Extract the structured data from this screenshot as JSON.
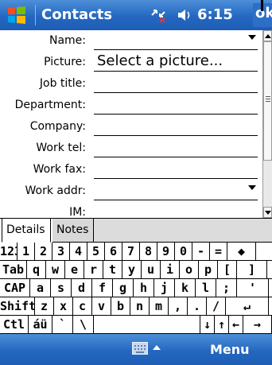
{
  "titlebar": {
    "title": "Contacts",
    "time": "6:15",
    "ok_label": "ok"
  },
  "form": {
    "fields": [
      {
        "label": "Name:",
        "value": "",
        "dropdown": true
      },
      {
        "label": "Picture:",
        "value": "Select a picture...",
        "dropdown": false
      },
      {
        "label": "Job title:",
        "value": "",
        "dropdown": false
      },
      {
        "label": "Department:",
        "value": "",
        "dropdown": false
      },
      {
        "label": "Company:",
        "value": "",
        "dropdown": false
      },
      {
        "label": "Work tel:",
        "value": "",
        "dropdown": false
      },
      {
        "label": "Work fax:",
        "value": "",
        "dropdown": false
      },
      {
        "label": "Work addr:",
        "value": "",
        "dropdown": true
      },
      {
        "label": "IM:",
        "value": "",
        "dropdown": false
      }
    ]
  },
  "tabs": {
    "details": "Details",
    "notes": "Notes"
  },
  "keyboard": {
    "row1": [
      "123",
      "1",
      "2",
      "3",
      "4",
      "5",
      "6",
      "7",
      "8",
      "9",
      "0",
      "-",
      "=",
      "◆"
    ],
    "row2": [
      "Tab",
      "q",
      "w",
      "e",
      "r",
      "t",
      "y",
      "u",
      "i",
      "o",
      "p",
      "[",
      "]"
    ],
    "row3": [
      "CAP",
      "a",
      "s",
      "d",
      "f",
      "g",
      "h",
      "j",
      "k",
      "l",
      ";",
      "'"
    ],
    "row4": [
      "Shift",
      "z",
      "x",
      "c",
      "v",
      "b",
      "n",
      "m",
      ",",
      ".",
      "/",
      "↵"
    ],
    "row5": [
      "Ctl",
      "áü",
      "`",
      "\\",
      "",
      "↓",
      "↑",
      "←",
      "→"
    ]
  },
  "menubar": {
    "menu_label": "Menu",
    "input_icon": "keyboard-icon"
  },
  "colors": {
    "bar": "#2467c0",
    "tab_inactive": "#dcdcdc"
  }
}
